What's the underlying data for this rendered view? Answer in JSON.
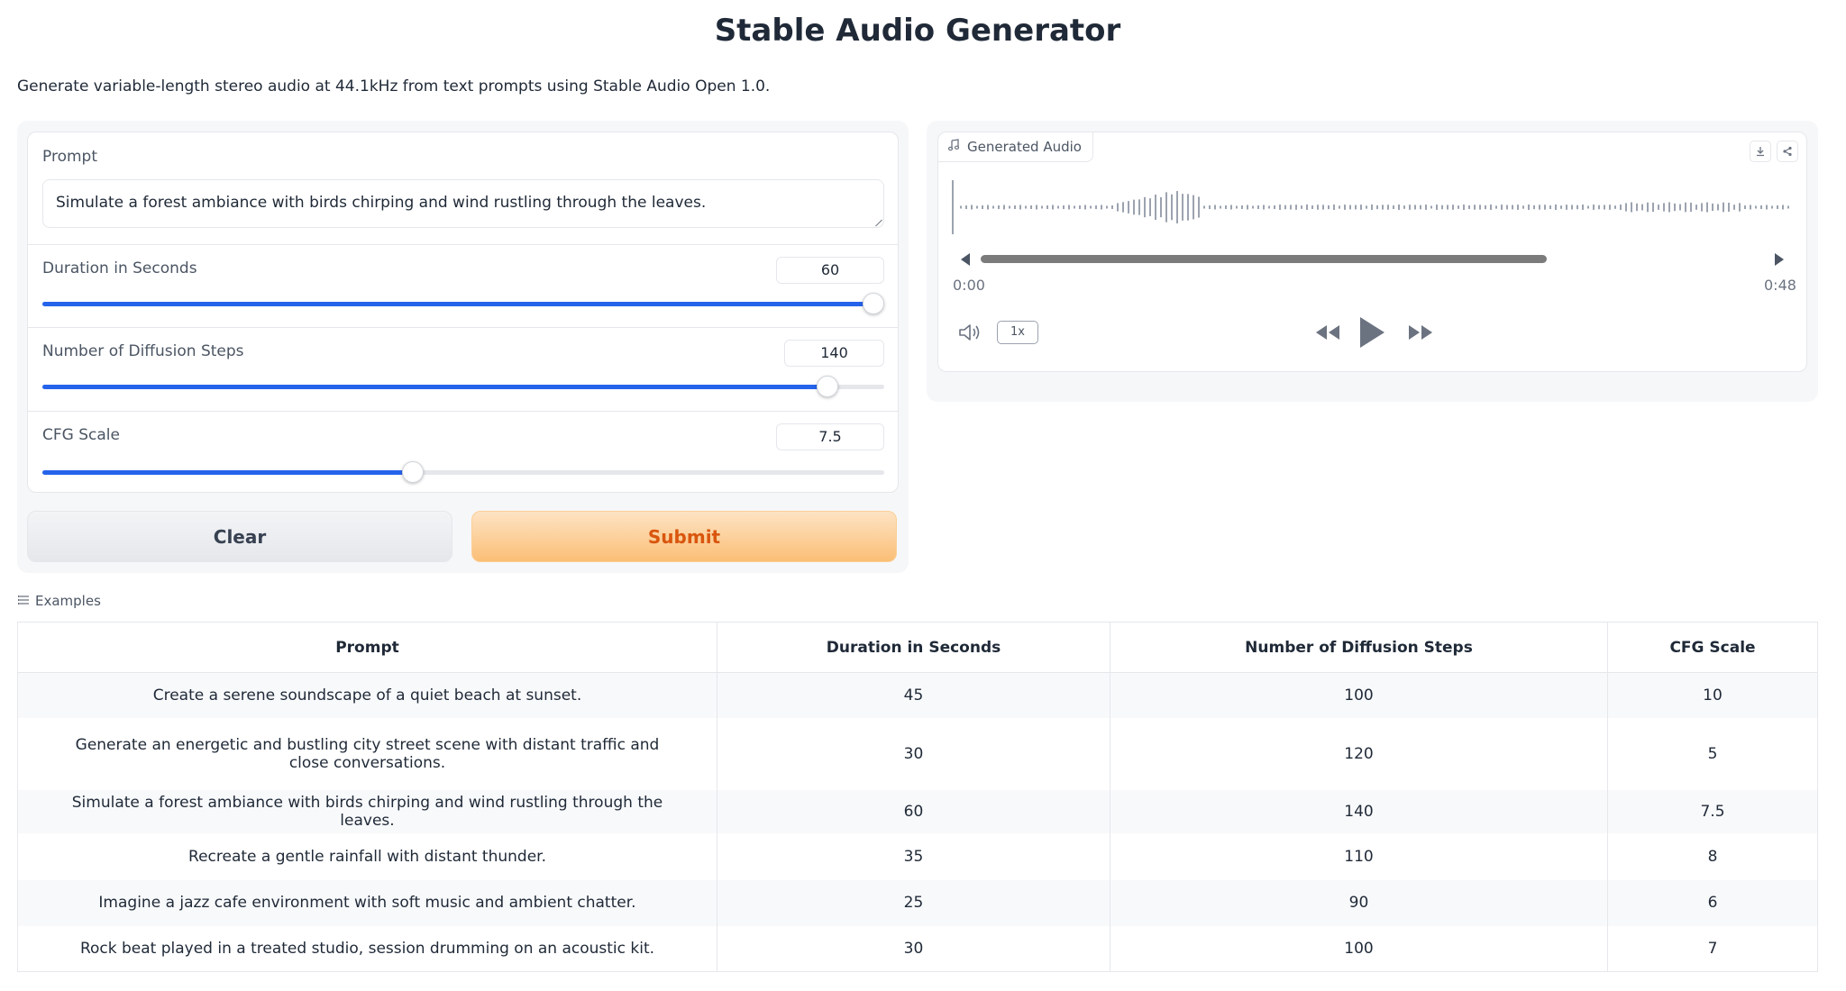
{
  "page": {
    "title": "Stable Audio Generator",
    "description": "Generate variable-length stereo audio at 44.1kHz from text prompts using Stable Audio Open 1.0."
  },
  "form": {
    "prompt": {
      "label": "Prompt",
      "value": "Simulate a forest ambiance with birds chirping and wind rustling through the leaves."
    },
    "duration": {
      "label": "Duration in Seconds",
      "value": "60",
      "fill_fraction": 0.987
    },
    "steps": {
      "label": "Number of Diffusion Steps",
      "value": "140",
      "fill_fraction": 0.933
    },
    "cfg": {
      "label": "CFG Scale",
      "value": "7.5",
      "fill_fraction": 0.44
    },
    "clear_label": "Clear",
    "submit_label": "Submit"
  },
  "audio": {
    "label": "Generated Audio",
    "current_time": "0:00",
    "total_time": "0:48",
    "speed": "1x",
    "progress_fraction": 0.0
  },
  "examples": {
    "label": "Examples",
    "headers": [
      "Prompt",
      "Duration in Seconds",
      "Number of Diffusion Steps",
      "CFG Scale"
    ],
    "rows": [
      [
        "Create a serene soundscape of a quiet beach at sunset.",
        "45",
        "100",
        "10"
      ],
      [
        "Generate an energetic and bustling city street scene with distant traffic and close conversations.",
        "30",
        "120",
        "5"
      ],
      [
        "Simulate a forest ambiance with birds chirping and wind rustling through the leaves.",
        "60",
        "140",
        "7.5"
      ],
      [
        "Recreate a gentle rainfall with distant thunder.",
        "35",
        "110",
        "8"
      ],
      [
        "Imagine a jazz cafe environment with soft music and ambient chatter.",
        "25",
        "90",
        "6"
      ],
      [
        "Rock beat played in a treated studio, session drumming on an acoustic kit.",
        "30",
        "100",
        "7"
      ]
    ]
  },
  "colors": {
    "accent": "#2563eb",
    "submit_text": "#d9560f",
    "submit_bg": "#fbbf76"
  }
}
